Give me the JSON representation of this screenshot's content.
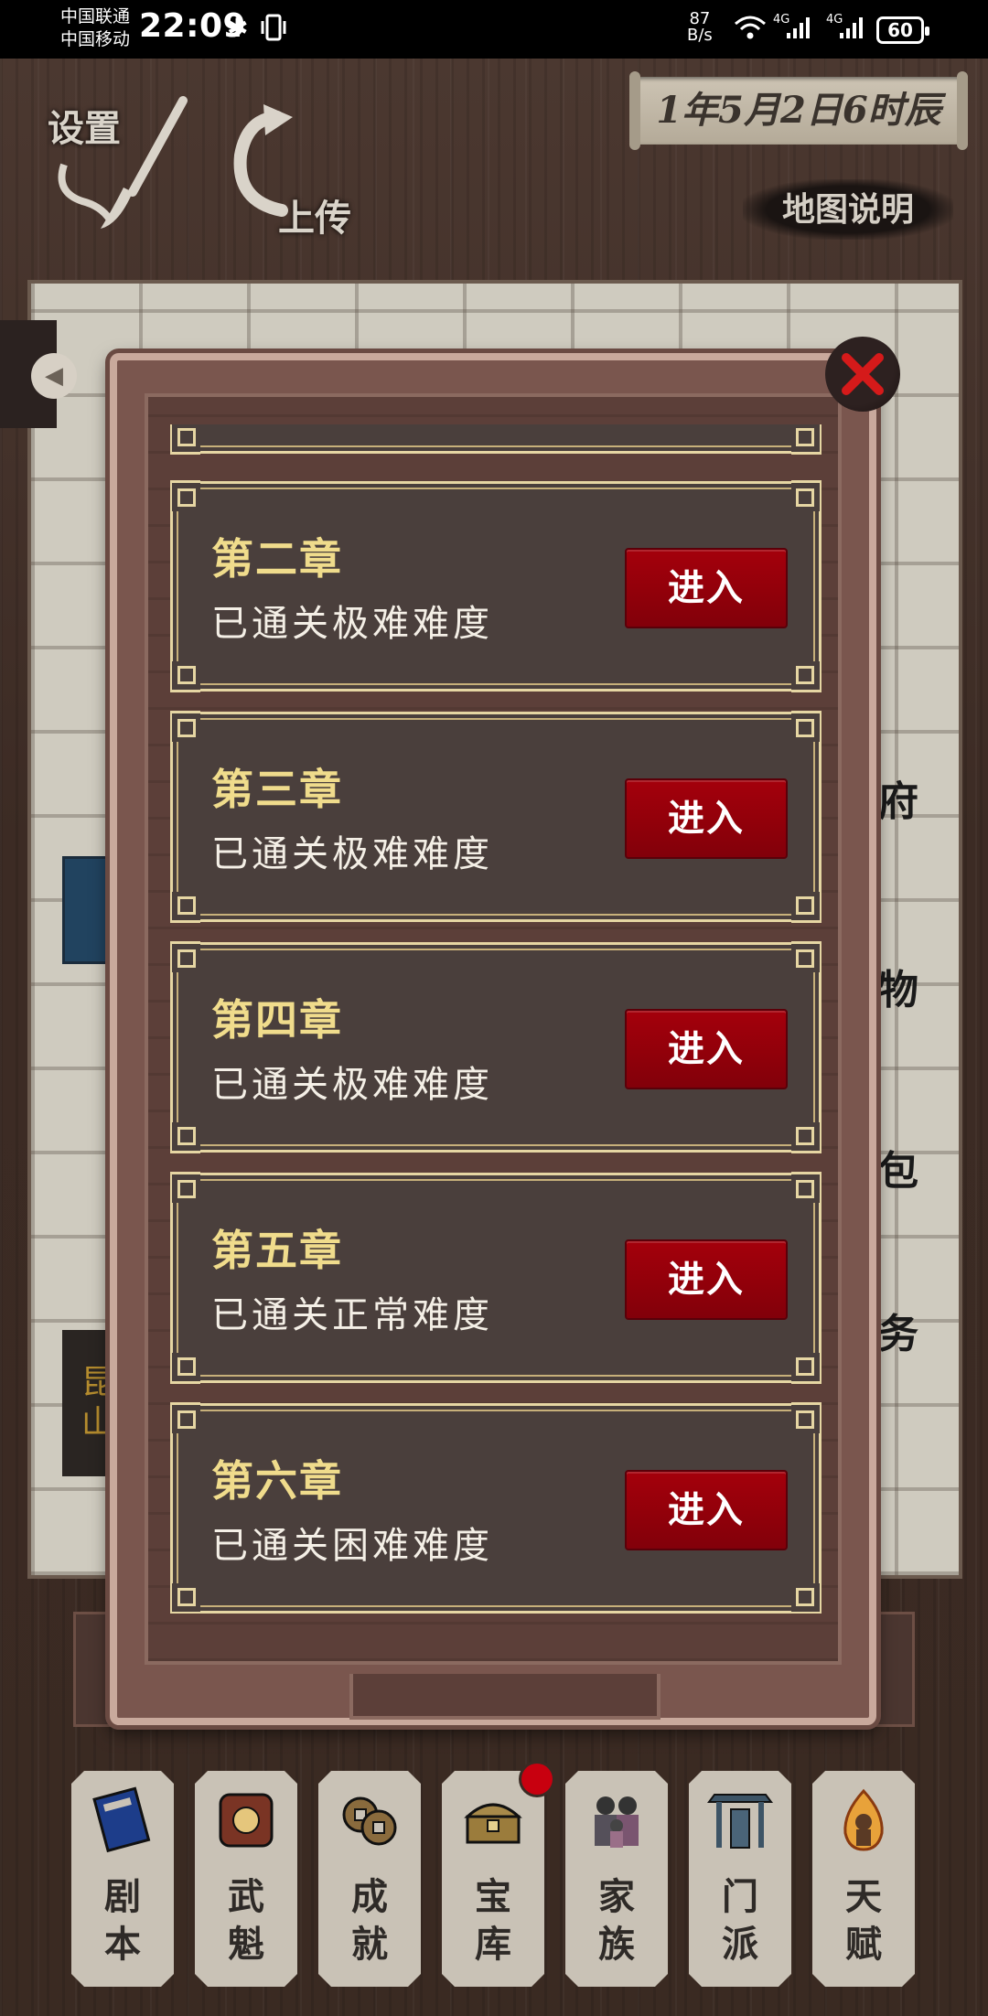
{
  "status_bar": {
    "carrier1": "中国联通",
    "carrier2": "中国移动",
    "time": "22:09",
    "net_speed_value": "87",
    "net_speed_unit": "B/s",
    "signal1": "4G",
    "signal2": "4G",
    "battery": "60"
  },
  "top": {
    "settings_label": "设置",
    "upload_label": "上传",
    "date": "1年5月2日6时辰",
    "map_help": "地图说明"
  },
  "map": {
    "kunshan": [
      "昆",
      "山"
    ],
    "right_labels": [
      "府",
      "物",
      "包",
      "务"
    ]
  },
  "chapters": [
    {
      "title": "第二章",
      "status": "已通关极难难度",
      "button": "进入"
    },
    {
      "title": "第三章",
      "status": "已通关极难难度",
      "button": "进入"
    },
    {
      "title": "第四章",
      "status": "已通关极难难度",
      "button": "进入"
    },
    {
      "title": "第五章",
      "status": "已通关正常难度",
      "button": "进入"
    },
    {
      "title": "第六章",
      "status": "已通关困难难度",
      "button": "进入"
    }
  ],
  "nav": [
    {
      "c1": "剧",
      "c2": "本",
      "icon": "book-icon"
    },
    {
      "c1": "武",
      "c2": "魁",
      "icon": "ranking-scroll-icon"
    },
    {
      "c1": "成",
      "c2": "就",
      "icon": "coins-icon"
    },
    {
      "c1": "宝",
      "c2": "库",
      "icon": "treasure-chest-icon"
    },
    {
      "c1": "家",
      "c2": "族",
      "icon": "family-icon"
    },
    {
      "c1": "门",
      "c2": "派",
      "icon": "gate-icon"
    },
    {
      "c1": "天",
      "c2": "赋",
      "icon": "flame-figure-icon"
    }
  ],
  "colors": {
    "enter_button": "#a4000b",
    "chapter_title": "#f0dc8c",
    "badge": "#c8000f"
  }
}
